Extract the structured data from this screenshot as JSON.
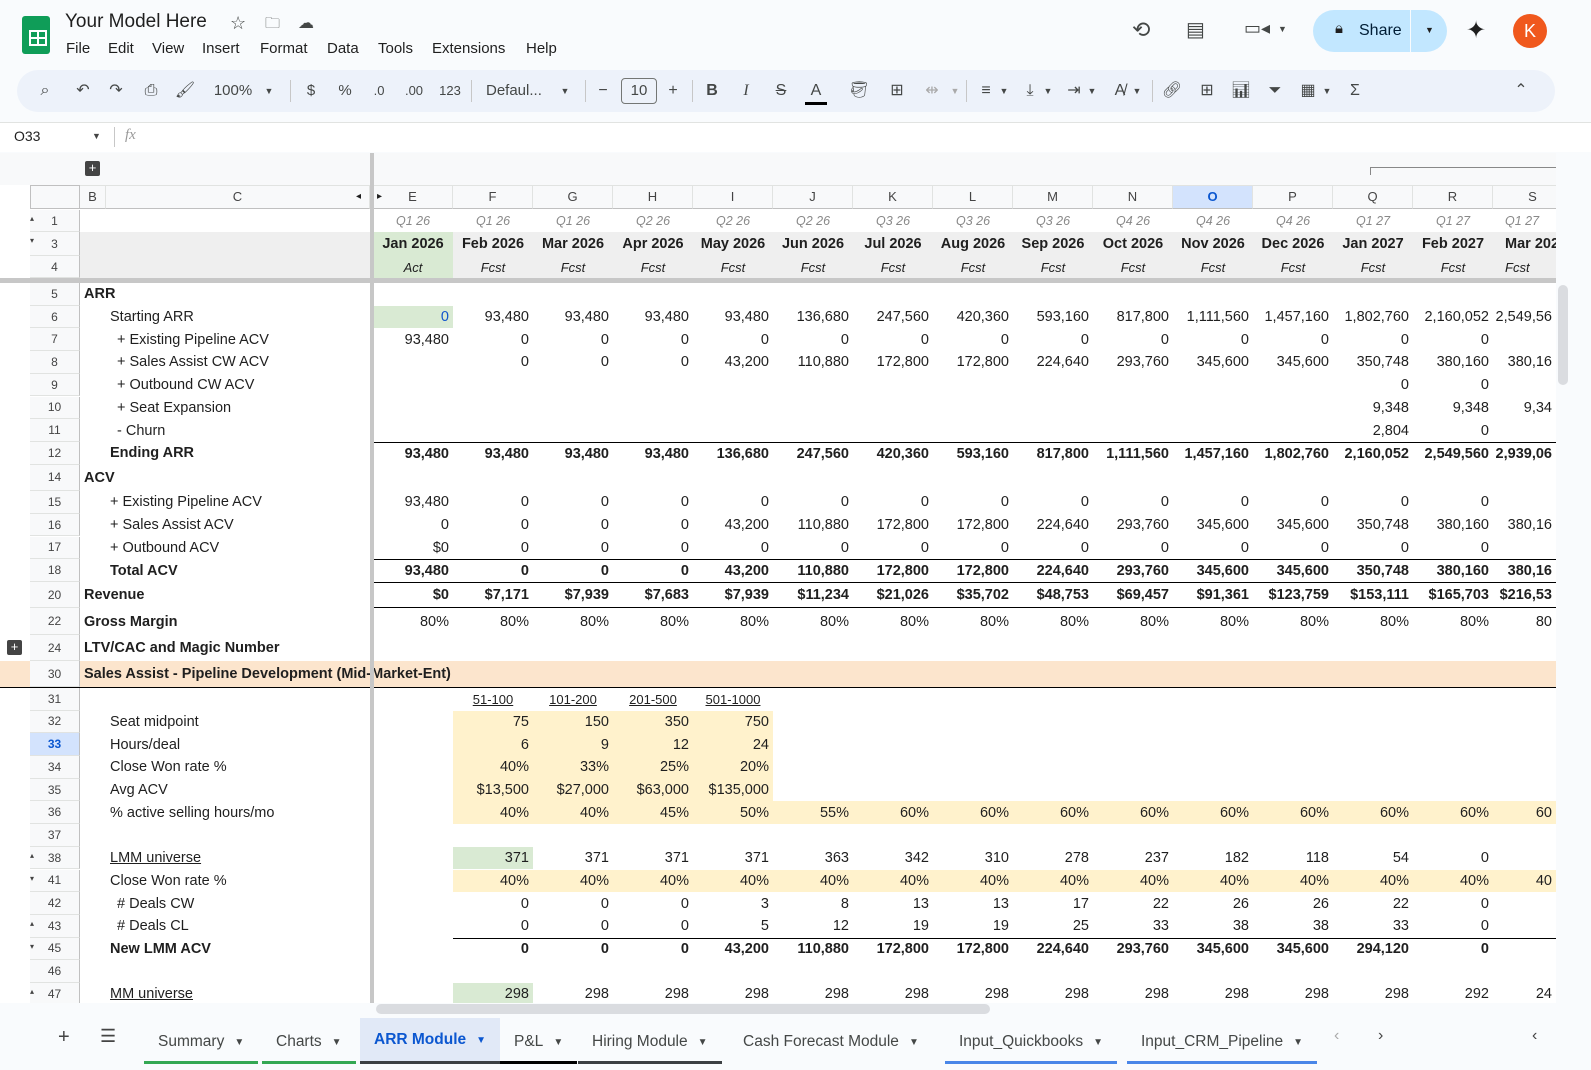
{
  "app": {
    "title": "Your Model Here",
    "menu": [
      "File",
      "Edit",
      "View",
      "Insert",
      "Format",
      "Data",
      "Tools",
      "Extensions",
      "Help"
    ],
    "share_label": "Share",
    "avatar_letter": "K"
  },
  "toolbar": {
    "zoom": "100%",
    "currency": "$",
    "percent": "%",
    "dec_decrease": ".0",
    "dec_increase": ".00",
    "number_format": "123",
    "font": "Defaul...",
    "font_size": "10",
    "bold": "B",
    "italic": "I",
    "strike": "S",
    "text_color": "A"
  },
  "formula_bar": {
    "cell_ref": "O33",
    "fx": "fx",
    "value": ""
  },
  "columns": [
    "B",
    "C",
    "E",
    "F",
    "G",
    "H",
    "I",
    "J",
    "K",
    "L",
    "M",
    "N",
    "O",
    "P",
    "Q",
    "R",
    "S"
  ],
  "selected_column": "O",
  "selected_row": "33",
  "header_rows": {
    "quarters": [
      "Q1 26",
      "Q1 26",
      "Q1 26",
      "Q2 26",
      "Q2 26",
      "Q2 26",
      "Q3 26",
      "Q3 26",
      "Q3 26",
      "Q4 26",
      "Q4 26",
      "Q4 26",
      "Q1 27",
      "Q1 27",
      "Q1 27"
    ],
    "months": [
      "Jan 2026",
      "Feb 2026",
      "Mar 2026",
      "Apr 2026",
      "May 2026",
      "Jun 2026",
      "Jul 2026",
      "Aug 2026",
      "Sep 2026",
      "Oct 2026",
      "Nov 2026",
      "Dec 2026",
      "Jan 2027",
      "Feb 2027",
      "Mar 202"
    ],
    "types": [
      "Act",
      "Fcst",
      "Fcst",
      "Fcst",
      "Fcst",
      "Fcst",
      "Fcst",
      "Fcst",
      "Fcst",
      "Fcst",
      "Fcst",
      "Fcst",
      "Fcst",
      "Fcst",
      "Fcst"
    ]
  },
  "rows": [
    {
      "num": "5",
      "label": "ARR",
      "values": []
    },
    {
      "num": "6",
      "label": "Starting ARR",
      "values": [
        "0",
        "93,480",
        "93,480",
        "93,480",
        "93,480",
        "136,680",
        "247,560",
        "420,360",
        "593,160",
        "817,800",
        "1,111,560",
        "1,457,160",
        "1,802,760",
        "2,160,052",
        "2,549,56"
      ]
    },
    {
      "num": "7",
      "label": "+ Existing Pipeline ACV",
      "values": [
        "93,480",
        "0",
        "0",
        "0",
        "0",
        "0",
        "0",
        "0",
        "0",
        "0",
        "0",
        "0",
        "0",
        "0",
        ""
      ]
    },
    {
      "num": "8",
      "label": "+ Sales Assist CW ACV",
      "values": [
        "",
        "0",
        "0",
        "0",
        "43,200",
        "110,880",
        "172,800",
        "172,800",
        "224,640",
        "293,760",
        "345,600",
        "345,600",
        "350,748",
        "380,160",
        "380,16"
      ]
    },
    {
      "num": "9",
      "label": "+ Outbound CW ACV",
      "values": [
        "",
        "",
        "",
        "",
        "",
        "",
        "",
        "",
        "",
        "",
        "",
        "",
        "0",
        "0",
        ""
      ]
    },
    {
      "num": "10",
      "label": "+ Seat Expansion",
      "values": [
        "",
        "",
        "",
        "",
        "",
        "",
        "",
        "",
        "",
        "",
        "",
        "",
        "9,348",
        "9,348",
        "9,34"
      ]
    },
    {
      "num": "11",
      "label": "- Churn",
      "values": [
        "",
        "",
        "",
        "",
        "",
        "",
        "",
        "",
        "",
        "",
        "",
        "",
        "2,804",
        "0",
        ""
      ]
    },
    {
      "num": "12",
      "label": "Ending ARR",
      "values": [
        "93,480",
        "93,480",
        "93,480",
        "93,480",
        "136,680",
        "247,560",
        "420,360",
        "593,160",
        "817,800",
        "1,111,560",
        "1,457,160",
        "1,802,760",
        "2,160,052",
        "2,549,560",
        "2,939,06"
      ]
    },
    {
      "num": "14",
      "label": "ACV",
      "values": []
    },
    {
      "num": "15",
      "label": "+ Existing Pipeline ACV",
      "values": [
        "93,480",
        "0",
        "0",
        "0",
        "0",
        "0",
        "0",
        "0",
        "0",
        "0",
        "0",
        "0",
        "0",
        "0",
        ""
      ]
    },
    {
      "num": "16",
      "label": "+ Sales Assist ACV",
      "values": [
        "0",
        "0",
        "0",
        "0",
        "43,200",
        "110,880",
        "172,800",
        "172,800",
        "224,640",
        "293,760",
        "345,600",
        "345,600",
        "350,748",
        "380,160",
        "380,16"
      ]
    },
    {
      "num": "17",
      "label": "+ Outbound ACV",
      "values": [
        "$0",
        "0",
        "0",
        "0",
        "0",
        "0",
        "0",
        "0",
        "0",
        "0",
        "0",
        "0",
        "0",
        "0",
        ""
      ]
    },
    {
      "num": "18",
      "label": "Total ACV",
      "values": [
        "93,480",
        "0",
        "0",
        "0",
        "43,200",
        "110,880",
        "172,800",
        "172,800",
        "224,640",
        "293,760",
        "345,600",
        "345,600",
        "350,748",
        "380,160",
        "380,16"
      ]
    },
    {
      "num": "20",
      "label": "Revenue",
      "values": [
        "$0",
        "$7,171",
        "$7,939",
        "$7,683",
        "$7,939",
        "$11,234",
        "$21,026",
        "$35,702",
        "$48,753",
        "$69,457",
        "$91,361",
        "$123,759",
        "$153,111",
        "$165,703",
        "$216,53"
      ]
    },
    {
      "num": "22",
      "label": "Gross Margin",
      "values": [
        "80%",
        "80%",
        "80%",
        "80%",
        "80%",
        "80%",
        "80%",
        "80%",
        "80%",
        "80%",
        "80%",
        "80%",
        "80%",
        "80%",
        "80"
      ]
    },
    {
      "num": "24",
      "label": "LTV/CAC and Magic Number",
      "values": []
    },
    {
      "num": "30",
      "label": "Sales Assist - Pipeline Development (Mid-Market-Ent)",
      "values": []
    },
    {
      "num": "31",
      "label": "",
      "values": [
        "",
        "51-100",
        "101-200",
        "201-500",
        "501-1000"
      ]
    },
    {
      "num": "32",
      "label": "Seat midpoint",
      "values": [
        "",
        "75",
        "150",
        "350",
        "750"
      ]
    },
    {
      "num": "33",
      "label": "Hours/deal",
      "values": [
        "",
        "6",
        "9",
        "12",
        "24"
      ]
    },
    {
      "num": "34",
      "label": "Close Won rate %",
      "values": [
        "",
        "40%",
        "33%",
        "25%",
        "20%"
      ]
    },
    {
      "num": "35",
      "label": "Avg ACV",
      "values": [
        "",
        "$13,500",
        "$27,000",
        "$63,000",
        "$135,000"
      ]
    },
    {
      "num": "36",
      "label": "% active selling hours/mo",
      "values": [
        "",
        "40%",
        "40%",
        "45%",
        "50%",
        "55%",
        "60%",
        "60%",
        "60%",
        "60%",
        "60%",
        "60%",
        "60%",
        "60%",
        "60"
      ]
    },
    {
      "num": "37",
      "label": "",
      "values": []
    },
    {
      "num": "38",
      "label": "LMM universe",
      "values": [
        "",
        "371",
        "371",
        "371",
        "371",
        "363",
        "342",
        "310",
        "278",
        "237",
        "182",
        "118",
        "54",
        "0",
        ""
      ]
    },
    {
      "num": "41",
      "label": "Close Won rate %",
      "values": [
        "",
        "40%",
        "40%",
        "40%",
        "40%",
        "40%",
        "40%",
        "40%",
        "40%",
        "40%",
        "40%",
        "40%",
        "40%",
        "40%",
        "40"
      ]
    },
    {
      "num": "42",
      "label": "# Deals CW",
      "values": [
        "",
        "0",
        "0",
        "0",
        "3",
        "8",
        "13",
        "13",
        "17",
        "22",
        "26",
        "26",
        "22",
        "0",
        ""
      ]
    },
    {
      "num": "43",
      "label": "# Deals CL",
      "values": [
        "",
        "0",
        "0",
        "0",
        "5",
        "12",
        "19",
        "19",
        "25",
        "33",
        "38",
        "38",
        "33",
        "0",
        ""
      ]
    },
    {
      "num": "45",
      "label": "New LMM ACV",
      "values": [
        "",
        "0",
        "0",
        "0",
        "43,200",
        "110,880",
        "172,800",
        "172,800",
        "224,640",
        "293,760",
        "345,600",
        "345,600",
        "294,120",
        "0",
        ""
      ]
    },
    {
      "num": "46",
      "label": "",
      "values": []
    },
    {
      "num": "47",
      "label": "MM universe",
      "values": [
        "",
        "298",
        "298",
        "298",
        "298",
        "298",
        "298",
        "298",
        "298",
        "298",
        "298",
        "298",
        "298",
        "292",
        "24"
      ]
    }
  ],
  "sheet_tabs": [
    {
      "label": "Summary",
      "color": "#34a853"
    },
    {
      "label": "Charts",
      "color": "#34a853"
    },
    {
      "label": "ARR Module",
      "color": "#3c4043",
      "active": true
    },
    {
      "label": "P&L",
      "color": "#000000"
    },
    {
      "label": "Hiring Module",
      "color": "#3c4043"
    },
    {
      "label": "Cash Forecast Module",
      "color": ""
    },
    {
      "label": "Input_Quickbooks",
      "color": "#4a86e8"
    },
    {
      "label": "Input_CRM_Pipeline",
      "color": "#4a86e8"
    }
  ],
  "colors": {
    "green": "#d9ead3",
    "yellow": "#fff2cc",
    "peach": "#fce5cd",
    "header_gray": "#efefef",
    "selected": "#d3e3fd",
    "accent": "#0b57d0"
  }
}
